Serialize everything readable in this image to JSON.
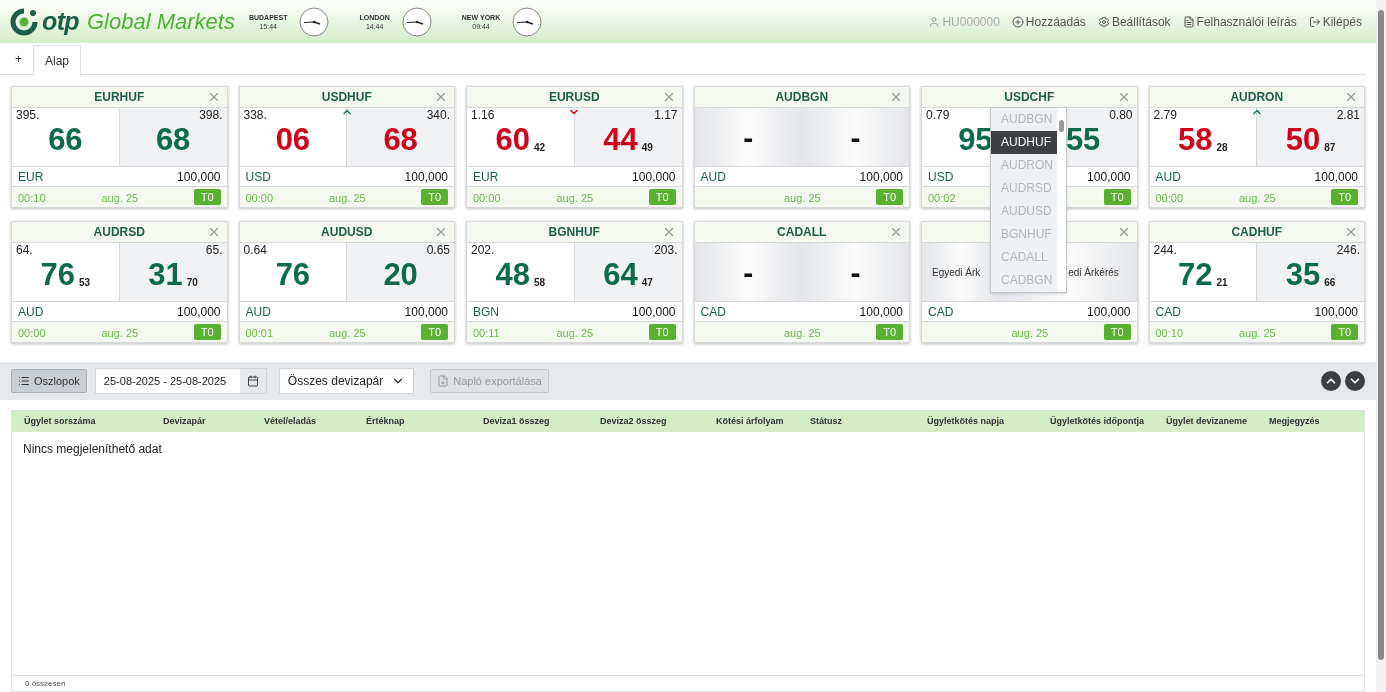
{
  "header": {
    "logo_mark": "otp",
    "logo_text": "Global Markets",
    "clocks": [
      {
        "city": "BUDAPEST",
        "time": "15:44"
      },
      {
        "city": "LONDON",
        "time": "14:44"
      },
      {
        "city": "NEW YORK",
        "time": "09:44"
      }
    ],
    "user": "HU000000",
    "links": [
      {
        "kind": "add",
        "label": "Hozzáadás"
      },
      {
        "kind": "settings",
        "label": "Beállítások"
      },
      {
        "kind": "manual",
        "label": "Felhasználói leírás"
      },
      {
        "kind": "logout",
        "label": "Kilépés"
      }
    ]
  },
  "tabs": [
    {
      "label": "+",
      "selected": false
    },
    {
      "label": "Alap",
      "selected": true
    }
  ],
  "cards": [
    {
      "kind": "quote",
      "pair": "EURHUF",
      "bid_prefix": "395.",
      "bid_big": "66",
      "ask_prefix": "398.",
      "ask_big": "68",
      "color": "#0b6b4b",
      "arrow_up": false,
      "arrow_down": false,
      "currency": "EUR",
      "amount": "100,000",
      "time": "00:10",
      "date": "aug. 25",
      "tenor": "T0"
    },
    {
      "kind": "quote",
      "pair": "USDHUF",
      "bid_prefix": "338.",
      "bid_big": "06",
      "ask_prefix": "340.",
      "ask_big": "68",
      "color": "#d0021b",
      "arrow_up": true,
      "arrow_down": false,
      "currency": "USD",
      "amount": "100,000",
      "time": "00:00",
      "date": "aug. 25",
      "tenor": "T0"
    },
    {
      "kind": "quote",
      "pair": "EURUSD",
      "bid_prefix": "1.16",
      "bid_big": "60",
      "bid_small": "42",
      "ask_prefix": "1.17",
      "ask_big": "44",
      "ask_small": "49",
      "color": "#d0021b",
      "arrow_up": false,
      "arrow_down": true,
      "currency": "EUR",
      "amount": "100,000",
      "time": "00:00",
      "date": "aug. 25",
      "tenor": "T0"
    },
    {
      "kind": "empty",
      "pair": "AUDBGN",
      "bid_big": "-",
      "ask_big": "-",
      "currency": "AUD",
      "amount": "100,000",
      "date": "aug. 25",
      "tenor": "T0"
    },
    {
      "kind": "quote",
      "pair": "USDCHF",
      "bid_prefix": "0.79",
      "bid_big": "95",
      "ask_prefix": "0.80",
      "ask_big": "55",
      "color": "#0b6b4b",
      "currency": "USD",
      "amount": "100,000",
      "time": "00:02",
      "tenor": "T0"
    },
    {
      "kind": "quote",
      "pair": "AUDRON",
      "bid_prefix": "2.79",
      "bid_big": "58",
      "bid_small": "28",
      "ask_prefix": "2.81",
      "ask_big": "50",
      "ask_small": "87",
      "color": "#d0021b",
      "arrow_up": true,
      "arrow_down": false,
      "currency": "AUD",
      "amount": "100,000",
      "time": "00:00",
      "date": "aug. 25",
      "tenor": "T0"
    },
    {
      "kind": "quote",
      "pair": "AUDRSD",
      "bid_prefix": "64.",
      "bid_big": "76",
      "bid_small": "53",
      "ask_prefix": "65.",
      "ask_big": "31",
      "ask_small": "70",
      "color": "#0b6b4b",
      "arrow_up": false,
      "arrow_down": false,
      "currency": "AUD",
      "amount": "100,000",
      "time": "00:00",
      "date": "aug. 25",
      "tenor": "T0"
    },
    {
      "kind": "quote",
      "pair": "AUDUSD",
      "bid_prefix": "0.64",
      "bid_big": "76",
      "ask_prefix": "0.65",
      "ask_big": "20",
      "color": "#0b6b4b",
      "arrow_up": false,
      "arrow_down": false,
      "currency": "AUD",
      "amount": "100,000",
      "time": "00:01",
      "date": "aug. 25",
      "tenor": "T0"
    },
    {
      "kind": "quote",
      "pair": "BGNHUF",
      "bid_prefix": "202.",
      "bid_big": "48",
      "bid_small": "58",
      "ask_prefix": "203.",
      "ask_big": "64",
      "ask_small": "47",
      "color": "#0b6b4b",
      "arrow_up": false,
      "arrow_down": false,
      "currency": "BGN",
      "amount": "100,000",
      "time": "00:11",
      "date": "aug. 25",
      "tenor": "T0"
    },
    {
      "kind": "empty",
      "pair": "CADALL",
      "bid_big": "-",
      "ask_big": "-",
      "currency": "CAD",
      "amount": "100,000",
      "date": "aug. 25",
      "tenor": "T0"
    },
    {
      "kind": "custom",
      "bid_text": "Egyedi Árk",
      "ask_text": "edi Árkérés",
      "currency": "CAD",
      "amount": "100,000",
      "date": "aug. 25",
      "tenor": "T0"
    },
    {
      "kind": "quote",
      "pair": "CADHUF",
      "bid_prefix": "244.",
      "bid_big": "72",
      "bid_small": "21",
      "ask_prefix": "246.",
      "ask_big": "35",
      "ask_small": "66",
      "color": "#0b6b4b",
      "arrow_up": false,
      "arrow_down": false,
      "currency": "CAD",
      "amount": "100,000",
      "time": "00:10",
      "date": "aug. 25",
      "tenor": "T0"
    }
  ],
  "pair_dropdown": {
    "options": [
      {
        "label": "AUDBGN",
        "selected": false
      },
      {
        "label": "AUDHUF",
        "selected": true
      },
      {
        "label": "AUDRON",
        "selected": false
      },
      {
        "label": "AUDRSD",
        "selected": false
      },
      {
        "label": "AUDUSD",
        "selected": false
      },
      {
        "label": "BGNHUF",
        "selected": false
      },
      {
        "label": "CADALL",
        "selected": false
      },
      {
        "label": "CADBGN",
        "selected": false
      }
    ]
  },
  "toolbar": {
    "columns_button": "Oszlopok",
    "date_range": "25-08-2025 - 25-08-2025",
    "pair_select": "Összes devizapár",
    "export_button": {
      "label": "Napló exportálása",
      "disabled": true
    }
  },
  "table": {
    "columns": [
      "Ügylet sorszáma",
      "Devizapár",
      "Vétel/eladás",
      "Értéknap",
      "Deviza1 összeg",
      "Deviza2 összeg",
      "Kötési árfolyam",
      "Státusz",
      "Ügyletkötés napja",
      "Ügyletkötés időpontja",
      "Ügylet devizaneme",
      "Megjegyzés"
    ],
    "empty_message": "Nincs megjeleníthető adat",
    "footer": "0 összesen"
  }
}
